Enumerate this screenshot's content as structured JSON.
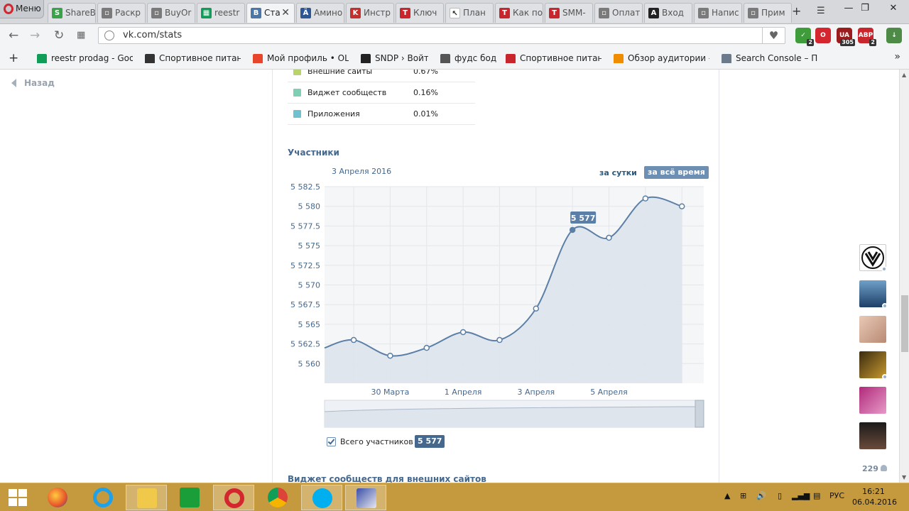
{
  "browser": {
    "menu_label": "Меню",
    "tabs": [
      {
        "label": "ShareB",
        "color": "#3aa34a",
        "glyph": "S"
      },
      {
        "label": "Раскр",
        "color": "#7a7a7a",
        "glyph": "▫"
      },
      {
        "label": "BuyOr",
        "color": "#7a7a7a",
        "glyph": "▫"
      },
      {
        "label": "reestr",
        "color": "#0f9d58",
        "glyph": "▦"
      },
      {
        "label": "Ста",
        "color": "#4a76a8",
        "glyph": "B"
      },
      {
        "label": "Амино",
        "color": "#2b5797",
        "glyph": "Ä"
      },
      {
        "label": "Инстр",
        "color": "#c4302b",
        "glyph": "K"
      },
      {
        "label": "Ключ",
        "color": "#c8262c",
        "glyph": "T"
      },
      {
        "label": "План",
        "color": "#ffffff",
        "glyph": "↖"
      },
      {
        "label": "Как по",
        "color": "#c8262c",
        "glyph": "T"
      },
      {
        "label": "SMM-",
        "color": "#c8262c",
        "glyph": "T"
      },
      {
        "label": "Оплат",
        "color": "#7a7a7a",
        "glyph": "▫"
      },
      {
        "label": "Вход",
        "color": "#222222",
        "glyph": "A"
      },
      {
        "label": "Напис",
        "color": "#7a7a7a",
        "glyph": "▫"
      },
      {
        "label": "Прим",
        "color": "#7a7a7a",
        "glyph": "▫"
      }
    ],
    "new_tab": "+",
    "url": "vk.com/stats",
    "extensions": [
      {
        "name": "shield",
        "color": "#3e9c3a",
        "glyph": "✓",
        "count": "2"
      },
      {
        "name": "opera",
        "color": "#d3262f",
        "glyph": "O",
        "count": ""
      },
      {
        "name": "ua",
        "color": "#9b1c1c",
        "glyph": "UA",
        "count": "305"
      },
      {
        "name": "abp",
        "color": "#c8262c",
        "glyph": "ABP",
        "count": "2"
      },
      {
        "name": "download",
        "color": "#4d8b46",
        "glyph": "↓",
        "count": ""
      }
    ],
    "bookmarks": [
      {
        "label": "reestr prodag - Goog",
        "color": "#0f9d58"
      },
      {
        "label": "Спортивное питание",
        "color": "#333333"
      },
      {
        "label": "Мой профиль • OLX",
        "color": "#e8462c",
        "prefix": "olx"
      },
      {
        "label": "SNDP › Войти",
        "color": "#222222"
      },
      {
        "label": "фудс боди",
        "color": "#555555"
      },
      {
        "label": "Спортивное питание",
        "color": "#c8262c"
      },
      {
        "label": "Обзор аудитории - G",
        "color": "#f08c00"
      },
      {
        "label": "Search Console – Пан",
        "color": "#6b7b8c"
      }
    ]
  },
  "page": {
    "back_label": "Назад",
    "sources": [
      {
        "label": "Внешние сайты",
        "value": "0.67%",
        "color": "#b8d36a"
      },
      {
        "label": "Виджет сообществ",
        "value": "0.16%",
        "color": "#7fcfb3"
      },
      {
        "label": "Приложения",
        "value": "0.01%",
        "color": "#6fc1cf"
      }
    ],
    "members_title": "Участники",
    "date_label": "3 Апреля 2016",
    "period_day": "за сутки",
    "period_all": "за всё время",
    "legend_label": "Всего участников",
    "legend_value": "5 577",
    "next_section_title": "Виджет сообществ для внешних сайтов",
    "friends_count": "229"
  },
  "chart_data": {
    "type": "area",
    "title": "",
    "xlabel": "",
    "ylabel": "",
    "ylim": [
      5557.5,
      5582.5
    ],
    "y_ticks": [
      5582.5,
      5580,
      5577.5,
      5575,
      5572.5,
      5570,
      5567.5,
      5565,
      5562.5,
      5560
    ],
    "y_tick_labels": [
      "5 582.5",
      "5 580",
      "5 577.5",
      "5 575",
      "5 572.5",
      "5 570",
      "5 567.5",
      "5 565",
      "5 562.5",
      "5 560"
    ],
    "x_tick_labels": [
      {
        "label": "30 Марта",
        "day": 2
      },
      {
        "label": "1 Апреля",
        "day": 4
      },
      {
        "label": "3 Апреля",
        "day": 6
      },
      {
        "label": "5 Апреля",
        "day": 8
      }
    ],
    "x_range": [
      0.2,
      10.6
    ],
    "grid": true,
    "series": [
      {
        "x": [
          0.2,
          1,
          2,
          3,
          4,
          5,
          6,
          7,
          8,
          9,
          10
        ],
        "values": [
          5562,
          5563,
          5561,
          5562,
          5564,
          5563,
          5567,
          5577,
          5576,
          5581,
          5580
        ]
      }
    ],
    "highlight": {
      "index": 7,
      "label": "5 577"
    },
    "colors": {
      "line": "#5b7fa6",
      "fill": "#dde4ec",
      "plot_bg": "#f5f6f8"
    }
  }
}
